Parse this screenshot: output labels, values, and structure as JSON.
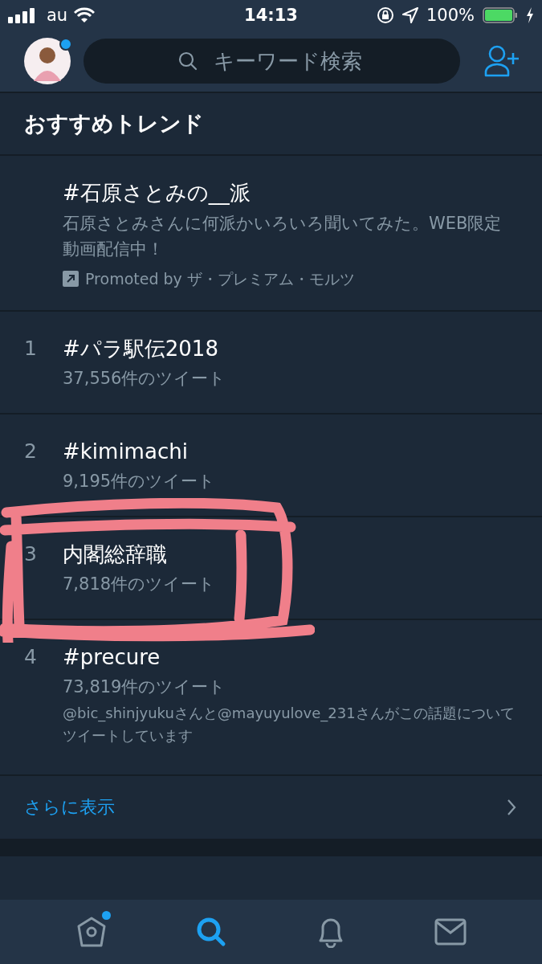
{
  "status_bar": {
    "carrier": "au",
    "time": "14:13",
    "battery": "100%"
  },
  "nav": {
    "avatar_notification": true,
    "search": {
      "placeholder": "キーワード検索"
    }
  },
  "section_title": "おすすめトレンド",
  "trends": [
    {
      "kind": "promoted",
      "name": "#石原さとみの__派",
      "description": "石原さとみさんに何派かいろいろ聞いてみた。WEB限定動画配信中！",
      "promoted_by": "Promoted by ザ・プレミアム・モルツ",
      "circled": false
    },
    {
      "kind": "ranked",
      "rank": "1",
      "name": "#パラ駅伝2018",
      "count": "37,556件のツイート",
      "circled": false
    },
    {
      "kind": "ranked",
      "rank": "2",
      "name": "#kimimachi",
      "count": "9,195件のツイート",
      "circled": false
    },
    {
      "kind": "ranked",
      "rank": "3",
      "name": "内閣総辞職",
      "count": "7,818件のツイート",
      "circled": true
    },
    {
      "kind": "ranked",
      "rank": "4",
      "name": "#precure",
      "count": "73,819件のツイート",
      "context": "@bic_shinjyukuさんと@mayuyulove_231さんがこの話題についてツイートしています",
      "circled": false
    }
  ],
  "show_more": "さらに表示",
  "tab_bar": [
    {
      "kind": "home",
      "selected": false,
      "badge": true
    },
    {
      "kind": "search",
      "selected": true,
      "badge": false
    },
    {
      "kind": "notifications",
      "selected": false,
      "badge": false
    },
    {
      "kind": "messages",
      "selected": false,
      "badge": false
    }
  ]
}
